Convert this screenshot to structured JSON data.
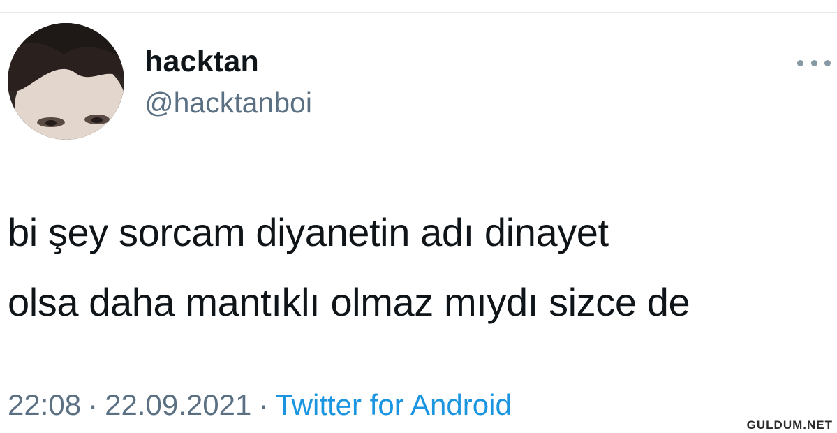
{
  "tweet": {
    "display_name": "hacktan",
    "handle": "@hacktanboi",
    "text": "bi şey sorcam diyanetin adı dinayet\nolsa daha mantıklı olmaz mıydı sizce de",
    "time": "22:08",
    "date": "22.09.2021",
    "separator": "·",
    "source": "Twitter for Android"
  },
  "watermark": "GULDUM.NET",
  "icons": {
    "more": "more-horizontal-icon",
    "avatar": "profile-photo"
  },
  "colors": {
    "text": "#0f1419",
    "secondary": "#5b7083",
    "link": "#1b95e0"
  }
}
